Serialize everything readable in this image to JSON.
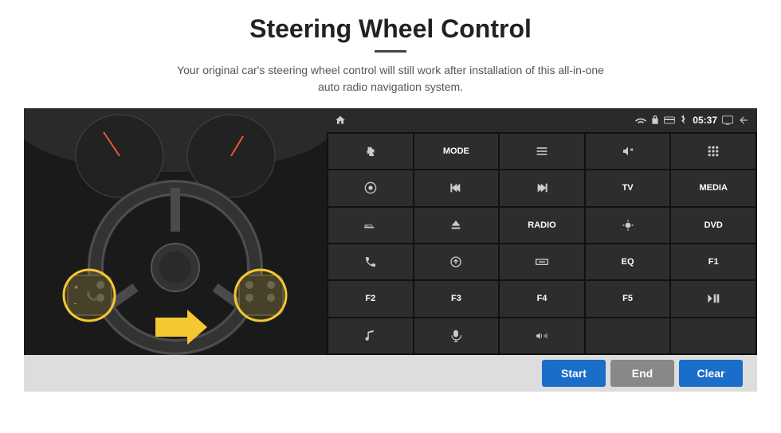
{
  "title": "Steering Wheel Control",
  "underline": true,
  "subtitle": "Your original car’s steering wheel control will still work after installation of this all-in-one\nauto radio navigation system.",
  "status_bar": {
    "wifi_icon": "wifi",
    "lock_icon": "lock",
    "card_icon": "card",
    "bt_icon": "bluetooth",
    "time": "05:37",
    "screen_icon": "screen",
    "back_icon": "back"
  },
  "button_rows": [
    [
      {
        "label": "",
        "icon": "nav-arrow",
        "row": 1,
        "col": 1
      },
      {
        "label": "MODE",
        "icon": "",
        "row": 1,
        "col": 2
      },
      {
        "label": "",
        "icon": "list",
        "row": 1,
        "col": 3
      },
      {
        "label": "",
        "icon": "vol-mute",
        "row": 1,
        "col": 4
      },
      {
        "label": "",
        "icon": "grid-dots",
        "row": 1,
        "col": 5
      }
    ],
    [
      {
        "label": "",
        "icon": "settings-circle",
        "row": 2,
        "col": 1
      },
      {
        "label": "",
        "icon": "prev",
        "row": 2,
        "col": 2
      },
      {
        "label": "",
        "icon": "next",
        "row": 2,
        "col": 3
      },
      {
        "label": "TV",
        "icon": "",
        "row": 2,
        "col": 4
      },
      {
        "label": "MEDIA",
        "icon": "",
        "row": 2,
        "col": 5
      }
    ],
    [
      {
        "label": "",
        "icon": "360-car",
        "row": 3,
        "col": 1
      },
      {
        "label": "",
        "icon": "eject",
        "row": 3,
        "col": 2
      },
      {
        "label": "RADIO",
        "icon": "",
        "row": 3,
        "col": 3
      },
      {
        "label": "",
        "icon": "brightness",
        "row": 3,
        "col": 4
      },
      {
        "label": "DVD",
        "icon": "",
        "row": 3,
        "col": 5
      }
    ],
    [
      {
        "label": "",
        "icon": "phone",
        "row": 4,
        "col": 1
      },
      {
        "label": "",
        "icon": "circle-arrow",
        "row": 4,
        "col": 2
      },
      {
        "label": "",
        "icon": "minus-rect",
        "row": 4,
        "col": 3
      },
      {
        "label": "EQ",
        "icon": "",
        "row": 4,
        "col": 4
      },
      {
        "label": "F1",
        "icon": "",
        "row": 4,
        "col": 5
      }
    ],
    [
      {
        "label": "F2",
        "icon": "",
        "row": 5,
        "col": 1
      },
      {
        "label": "F3",
        "icon": "",
        "row": 5,
        "col": 2
      },
      {
        "label": "F4",
        "icon": "",
        "row": 5,
        "col": 3
      },
      {
        "label": "F5",
        "icon": "",
        "row": 5,
        "col": 4
      },
      {
        "label": "",
        "icon": "play-pause",
        "row": 5,
        "col": 5
      }
    ],
    [
      {
        "label": "",
        "icon": "music-note",
        "row": 6,
        "col": 1
      },
      {
        "label": "",
        "icon": "microphone",
        "row": 6,
        "col": 2
      },
      {
        "label": "",
        "icon": "vol-down-up",
        "row": 6,
        "col": 3
      },
      {
        "label": "",
        "icon": "",
        "row": 6,
        "col": 4
      },
      {
        "label": "",
        "icon": "",
        "row": 6,
        "col": 5
      }
    ]
  ],
  "bottom_buttons": {
    "start": "Start",
    "end": "End",
    "clear": "Clear"
  }
}
